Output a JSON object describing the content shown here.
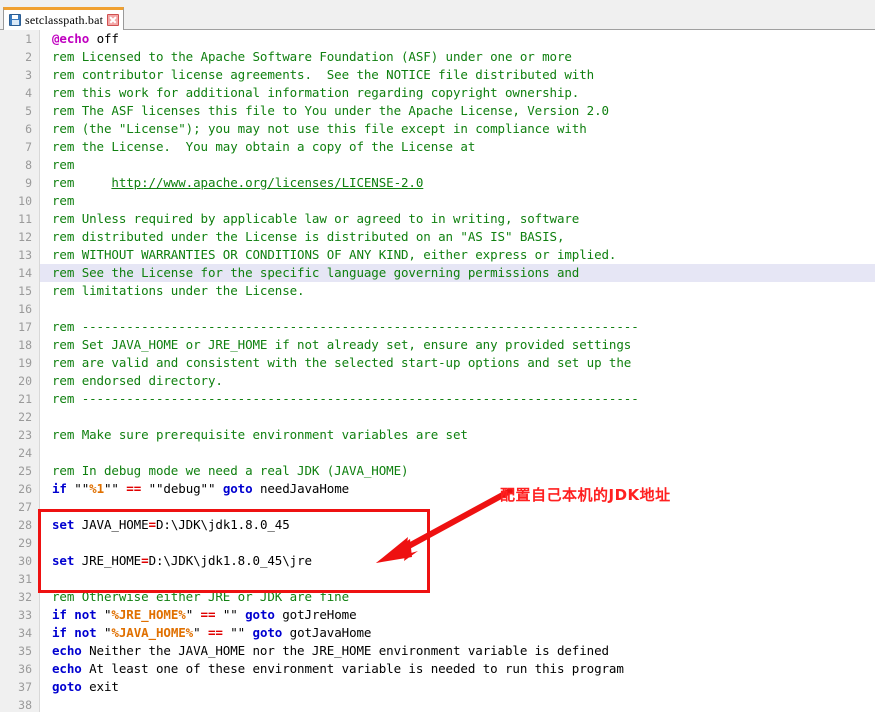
{
  "window": {
    "title": "setclasspath.bat"
  },
  "tab": {
    "label": "setclasspath.bat",
    "save_icon": "save-floppy-icon",
    "close_icon": "close-x-icon",
    "active_accent_color": "#f0a030"
  },
  "colors": {
    "comment": "#108010",
    "keyword": "#0000d0",
    "operator": "#e00000",
    "variable": "#e07000",
    "at_echo": "#c000c0",
    "annotation_red": "#ff2020",
    "highlight_box": "#ee1111",
    "current_line": "#e6e6f5",
    "gutter_bg": "#f0f0f0",
    "line_number": "#9a9a9a"
  },
  "annotation": {
    "text": "配置自己本机的JDK地址",
    "arrow": "red-arrow-pointing-down-left",
    "box": "red-rectangle-highlight"
  },
  "editor": {
    "current_line_number": 14,
    "first_line": 1,
    "last_visible_line": 38,
    "lines": [
      {
        "n": 1,
        "tokens": [
          {
            "c": "at",
            "t": "@echo"
          },
          {
            "c": "txt",
            "t": " off"
          }
        ]
      },
      {
        "n": 2,
        "tokens": [
          {
            "c": "cmt",
            "t": "rem Licensed to the Apache Software Foundation (ASF) under one or more"
          }
        ]
      },
      {
        "n": 3,
        "tokens": [
          {
            "c": "cmt",
            "t": "rem contributor license agreements.  See the NOTICE file distributed with"
          }
        ]
      },
      {
        "n": 4,
        "tokens": [
          {
            "c": "cmt",
            "t": "rem this work for additional information regarding copyright ownership."
          }
        ]
      },
      {
        "n": 5,
        "tokens": [
          {
            "c": "cmt",
            "t": "rem The ASF licenses this file to You under the Apache License, Version 2.0"
          }
        ]
      },
      {
        "n": 6,
        "tokens": [
          {
            "c": "cmt",
            "t": "rem (the \"License\"); you may not use this file except in compliance with"
          }
        ]
      },
      {
        "n": 7,
        "tokens": [
          {
            "c": "cmt",
            "t": "rem the License.  You may obtain a copy of the License at"
          }
        ]
      },
      {
        "n": 8,
        "tokens": [
          {
            "c": "cmt",
            "t": "rem"
          }
        ]
      },
      {
        "n": 9,
        "tokens": [
          {
            "c": "cmt",
            "t": "rem     "
          },
          {
            "c": "url",
            "t": "http://www.apache.org/licenses/LICENSE-2.0"
          }
        ]
      },
      {
        "n": 10,
        "tokens": [
          {
            "c": "cmt",
            "t": "rem"
          }
        ]
      },
      {
        "n": 11,
        "tokens": [
          {
            "c": "cmt",
            "t": "rem Unless required by applicable law or agreed to in writing, software"
          }
        ]
      },
      {
        "n": 12,
        "tokens": [
          {
            "c": "cmt",
            "t": "rem distributed under the License is distributed on an \"AS IS\" BASIS,"
          }
        ]
      },
      {
        "n": 13,
        "tokens": [
          {
            "c": "cmt",
            "t": "rem WITHOUT WARRANTIES OR CONDITIONS OF ANY KIND, either express or implied."
          }
        ]
      },
      {
        "n": 14,
        "tokens": [
          {
            "c": "cmt",
            "t": "rem See the License for the specific language governing permissions and"
          }
        ],
        "current": true
      },
      {
        "n": 15,
        "tokens": [
          {
            "c": "cmt",
            "t": "rem limitations under the License."
          }
        ]
      },
      {
        "n": 16,
        "tokens": []
      },
      {
        "n": 17,
        "tokens": [
          {
            "c": "cmt",
            "t": "rem ---------------------------------------------------------------------------"
          }
        ]
      },
      {
        "n": 18,
        "tokens": [
          {
            "c": "cmt",
            "t": "rem Set JAVA_HOME or JRE_HOME if not already set, ensure any provided settings"
          }
        ]
      },
      {
        "n": 19,
        "tokens": [
          {
            "c": "cmt",
            "t": "rem are valid and consistent with the selected start-up options and set up the"
          }
        ]
      },
      {
        "n": 20,
        "tokens": [
          {
            "c": "cmt",
            "t": "rem endorsed directory."
          }
        ]
      },
      {
        "n": 21,
        "tokens": [
          {
            "c": "cmt",
            "t": "rem ---------------------------------------------------------------------------"
          }
        ]
      },
      {
        "n": 22,
        "tokens": []
      },
      {
        "n": 23,
        "tokens": [
          {
            "c": "cmt",
            "t": "rem Make sure prerequisite environment variables are set"
          }
        ]
      },
      {
        "n": 24,
        "tokens": []
      },
      {
        "n": 25,
        "tokens": [
          {
            "c": "cmt",
            "t": "rem In debug mode we need a real JDK (JAVA_HOME)"
          }
        ]
      },
      {
        "n": 26,
        "tokens": [
          {
            "c": "kw",
            "t": "if"
          },
          {
            "c": "txt",
            "t": " \"\""
          },
          {
            "c": "var",
            "t": "%1"
          },
          {
            "c": "txt",
            "t": "\"\" "
          },
          {
            "c": "op",
            "t": "=="
          },
          {
            "c": "txt",
            "t": " \"\"debug\"\" "
          },
          {
            "c": "kw",
            "t": "goto"
          },
          {
            "c": "txt",
            "t": " needJavaHome"
          }
        ]
      },
      {
        "n": 27,
        "tokens": []
      },
      {
        "n": 28,
        "tokens": [
          {
            "c": "kw",
            "t": "set"
          },
          {
            "c": "txt",
            "t": " JAVA_HOME"
          },
          {
            "c": "op",
            "t": "="
          },
          {
            "c": "txt",
            "t": "D:\\JDK\\jdk1.8.0_45"
          }
        ]
      },
      {
        "n": 29,
        "tokens": []
      },
      {
        "n": 30,
        "tokens": [
          {
            "c": "kw",
            "t": "set"
          },
          {
            "c": "txt",
            "t": " JRE_HOME"
          },
          {
            "c": "op",
            "t": "="
          },
          {
            "c": "txt",
            "t": "D:\\JDK\\jdk1.8.0_45\\jre"
          }
        ]
      },
      {
        "n": 31,
        "tokens": []
      },
      {
        "n": 32,
        "tokens": [
          {
            "c": "cmt",
            "t": "rem Otherwise either JRE or JDK are fine"
          }
        ]
      },
      {
        "n": 33,
        "tokens": [
          {
            "c": "kw",
            "t": "if not"
          },
          {
            "c": "txt",
            "t": " \""
          },
          {
            "c": "var",
            "t": "%JRE_HOME%"
          },
          {
            "c": "txt",
            "t": "\" "
          },
          {
            "c": "op",
            "t": "=="
          },
          {
            "c": "txt",
            "t": " \"\" "
          },
          {
            "c": "kw",
            "t": "goto"
          },
          {
            "c": "txt",
            "t": " gotJreHome"
          }
        ]
      },
      {
        "n": 34,
        "tokens": [
          {
            "c": "kw",
            "t": "if not"
          },
          {
            "c": "txt",
            "t": " \""
          },
          {
            "c": "var",
            "t": "%JAVA_HOME%"
          },
          {
            "c": "txt",
            "t": "\" "
          },
          {
            "c": "op",
            "t": "=="
          },
          {
            "c": "txt",
            "t": " \"\" "
          },
          {
            "c": "kw",
            "t": "goto"
          },
          {
            "c": "txt",
            "t": " gotJavaHome"
          }
        ]
      },
      {
        "n": 35,
        "tokens": [
          {
            "c": "kw",
            "t": "echo"
          },
          {
            "c": "txt",
            "t": " Neither the JAVA_HOME nor the JRE_HOME environment variable is defined"
          }
        ]
      },
      {
        "n": 36,
        "tokens": [
          {
            "c": "kw",
            "t": "echo"
          },
          {
            "c": "txt",
            "t": " At least one of these environment variable is needed to run this program"
          }
        ]
      },
      {
        "n": 37,
        "tokens": [
          {
            "c": "kw",
            "t": "goto"
          },
          {
            "c": "txt",
            "t": " exit"
          }
        ]
      },
      {
        "n": 38,
        "tokens": []
      }
    ]
  }
}
